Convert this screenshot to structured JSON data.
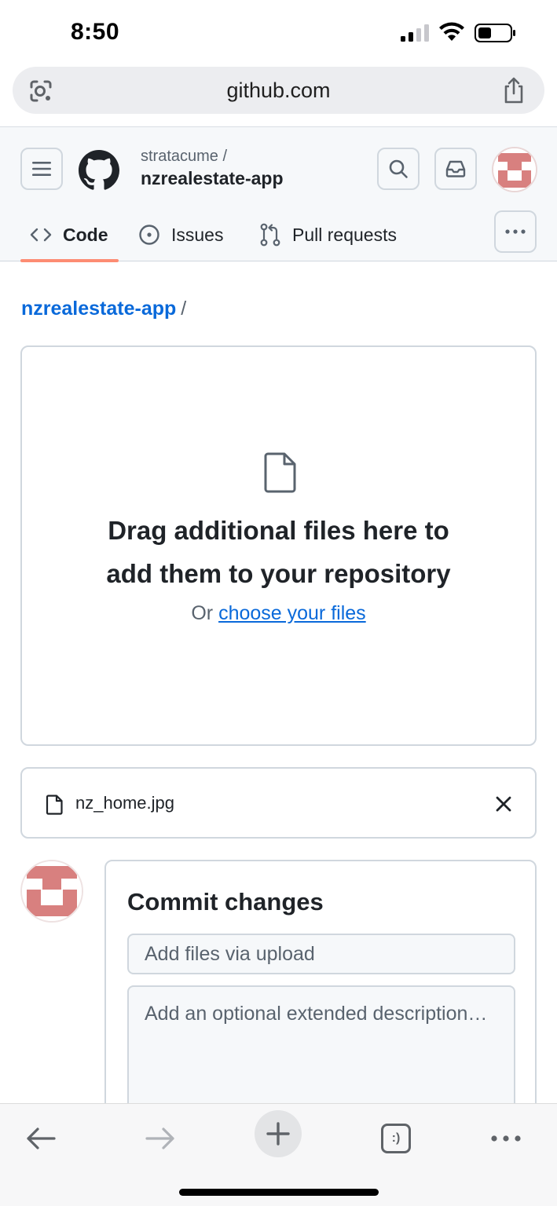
{
  "status_bar": {
    "time": "8:50"
  },
  "browser": {
    "url": "github.com",
    "tabs_label": ":)"
  },
  "header": {
    "owner": "stratacume /",
    "repo": "nzrealestate-app",
    "tabs": [
      {
        "label": "Code",
        "selected": true
      },
      {
        "label": "Issues"
      },
      {
        "label": "Pull requests"
      }
    ]
  },
  "breadcrumb": {
    "repo": "nzrealestate-app",
    "separator": "/"
  },
  "dropzone": {
    "title_line1": "Drag additional files here to",
    "title_line2": "add them to your repository",
    "prefix": "Or",
    "link": "choose your files"
  },
  "file": {
    "name": "nz_home.jpg"
  },
  "commit": {
    "title": "Commit changes",
    "summary_placeholder": "Add files via upload",
    "description_placeholder": "Add an optional extended description…"
  },
  "colors": {
    "accent_link": "#0969da",
    "tab_underline": "#fd8c73",
    "avatar": "#d8807f",
    "border": "#d0d7de"
  }
}
